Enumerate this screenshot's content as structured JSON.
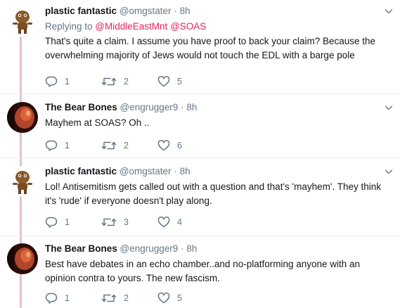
{
  "tweets": [
    {
      "name": "plastic fantastic",
      "handle": "@omgstater",
      "separator": "·",
      "time": "8h",
      "reply_prefix": "Replying to ",
      "reply_mention_1": "@MiddleEastMnt",
      "reply_mention_2": "@SOAS",
      "text": "That's quite a claim. I assume you have proof to back your claim? Because the overwhelming majority of Jews would not touch the EDL with a barge pole",
      "replies": "1",
      "retweets": "2",
      "likes": "5"
    },
    {
      "name": "The Bear Bones",
      "handle": "@engrugger9",
      "separator": "·",
      "time": "8h",
      "text": "Mayhem at SOAS? Oh ..",
      "replies": "1",
      "retweets": "2",
      "likes": "6"
    },
    {
      "name": "plastic fantastic",
      "handle": "@omgstater",
      "separator": "·",
      "time": "8h",
      "text": "Lol! Antisemitism gets called out with a question and that's 'mayhem'. They think it's 'rude' if everyone doesn't play along.",
      "replies": "1",
      "retweets": "3",
      "likes": "4"
    },
    {
      "name": "The Bear Bones",
      "handle": "@engrugger9",
      "separator": "·",
      "time": "8h",
      "text": "Best have debates in an echo chamber..and no-platforming anyone with an opinion contra to yours. The new fascism.",
      "replies": "1",
      "retweets": "2",
      "likes": "5"
    }
  ],
  "icons": {
    "reply": "reply-icon",
    "retweet": "retweet-icon",
    "like": "heart-icon",
    "more": "chevron-down-icon"
  },
  "colors": {
    "name": "#14171a",
    "secondary": "#657786",
    "mention": "#e0245e",
    "thread_line": "#e1c3c7",
    "action_icon": "#657786"
  }
}
